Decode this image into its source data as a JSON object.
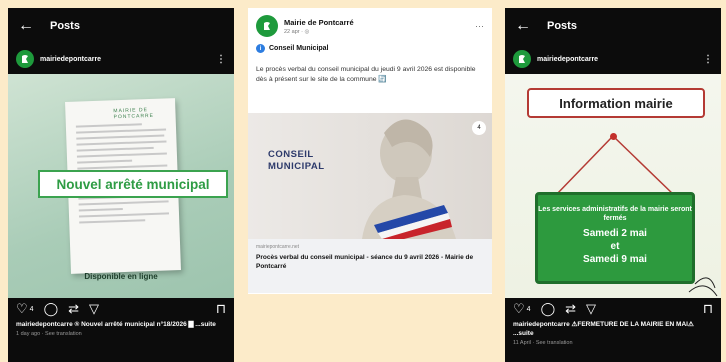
{
  "left_post": {
    "back": "←",
    "header_title": "Posts",
    "username": "mairiedepontcarre",
    "more": "⋮",
    "image_banner": "Nouvel arrêté municipal",
    "doc_header": "MAIRIE DE PONTCARRE",
    "image_footer": "Disponible en ligne",
    "actions": {
      "like": "♡",
      "comment": "◯",
      "repost": "⇄",
      "share": "▽",
      "save": "⊓"
    },
    "likes": "4",
    "caption": "mairiedepontcarre ® Nouvel arrêté municipal n°18/2026 ▇ ...suite",
    "meta": "1 day ago · See translation"
  },
  "center_post": {
    "page_name": "Mairie de Pontcarré",
    "time": "22 apr · ◎",
    "more": "···",
    "subtitle": "Conseil Municipal",
    "body": "Le procès verbal du conseil municipal du jeudi 9 avril 2026 est disponible dès à présent sur le site de la commune 🔄",
    "image_label_1": "CONSEIL",
    "image_label_2": "MUNICIPAL",
    "image_badge": "4",
    "link_host": "mairiepontcarre.net",
    "link_title": "Procès verbal du conseil municipal - séance du 9 avril 2026 - Mairie de Pontcarré"
  },
  "right_post": {
    "back": "←",
    "header_title": "Posts",
    "username": "mairiedepontcarre",
    "more": "⋮",
    "sign_title": "Information mairie",
    "board_line": "Les services administratifs de la mairie seront fermés",
    "date1": "Samedi 2 mai",
    "et": "et",
    "date2": "Samedi 9 mai",
    "actions": {
      "like": "♡",
      "comment": "◯",
      "repost": "⇄",
      "share": "▽",
      "save": "⊓"
    },
    "likes": "4",
    "caption": "mairiedepontcarre ⚠FERMETURE DE LA MAIRIE EN MAI⚠ ...suite",
    "meta": "11 April · See translation"
  },
  "colors": {
    "background": "#fcebc9",
    "accent_green": "#2d9a3e",
    "sign_red": "#b43a34"
  }
}
